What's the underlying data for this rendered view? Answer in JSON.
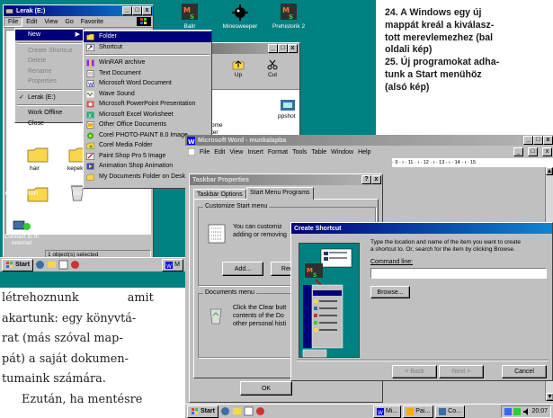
{
  "caption": {
    "line1": "24. A Windows egy új",
    "line2": "mappát kreál a kiválasz-",
    "line3": "tott merevlemezhez (bal",
    "line4": "oldali kép)",
    "line5": "25. Új programokat adha-",
    "line6": "tunk a Start menühöz",
    "line7": "(alsó kép)"
  },
  "body_text": {
    "line1": "létrehoznunk amit",
    "line2": "akartunk: egy könyvtá-",
    "line3": "rat (más szóval map-",
    "line4": "pát) a saját dokumen-",
    "line5": "tumaink számára.",
    "line6": "Ezután, ha mentésre"
  },
  "desktop_icons": [
    {
      "label": "Ballr",
      "icon": "ms-logo-icon"
    },
    {
      "label": "Minesweeper",
      "icon": "mine-icon"
    },
    {
      "label": "Prehistorik 2",
      "icon": "ms-logo-icon"
    }
  ],
  "explorer": {
    "title": "Lerak (E:)",
    "menu": [
      "File",
      "Edit",
      "View",
      "Go",
      "Favorite"
    ],
    "file_menu": [
      {
        "label": "New",
        "highlight": true
      },
      {
        "label": "Create Shortcut",
        "disabled": true
      },
      {
        "label": "Delete",
        "disabled": true
      },
      {
        "label": "Rename",
        "disabled": true
      },
      {
        "label": "Properties",
        "disabled": true
      },
      {
        "label": "Lerak (E:)",
        "checked": true
      },
      {
        "label": "Work Offline"
      },
      {
        "label": "Close"
      }
    ],
    "new_submenu": [
      {
        "label": "Folder",
        "icon": "folder-icon",
        "highlight": true
      },
      {
        "label": "Shortcut",
        "icon": "shortcut-icon"
      },
      {
        "label": "WinRAR archive",
        "icon": "winrar-icon"
      },
      {
        "label": "Text Document",
        "icon": "text-doc-icon"
      },
      {
        "label": "Microsoft Word Document",
        "icon": "word-doc-icon"
      },
      {
        "label": "Wave Sound",
        "icon": "wave-sound-icon"
      },
      {
        "label": "Microsoft PowerPoint Presentation",
        "icon": "powerpoint-icon"
      },
      {
        "label": "Microsoft Excel Worksheet",
        "icon": "excel-icon"
      },
      {
        "label": "Other Office Documents",
        "icon": "office-doc-icon"
      },
      {
        "label": "Corel PHOTO-PAINT 8.0 Image",
        "icon": "corel-icon"
      },
      {
        "label": "Corel Media Folder",
        "icon": "corel-media-icon"
      },
      {
        "label": "Paint Shop Pro 5 Image",
        "icon": "paint-shop-icon"
      },
      {
        "label": "Animation Shop Animation",
        "icon": "animation-icon"
      },
      {
        "label": "My Documents Folder on Desktop",
        "icon": "folder-icon"
      }
    ],
    "folders": [
      "hair",
      "kepek"
    ],
    "status": "1 object(s) selected"
  },
  "explorer_partial": {
    "tool_labels": [
      "Up",
      "Cut"
    ],
    "item1": "ppshot",
    "item2": "agnes",
    "item3": "pme",
    "item4": "ter"
  },
  "desktop_left": {
    "icon1_label_a": "COMPLRAR",
    "icon1_label_b": "(2)",
    "icon2_label_a": "Connect to th",
    "icon2_label_b": "Internet",
    "scheduled": "Scheduled Tasks"
  },
  "taskbar_top": {
    "start": "Start",
    "btn": "M"
  },
  "word": {
    "title": "Microsoft Word - munkalapba",
    "menu": [
      "File",
      "Edit",
      "View",
      "Insert",
      "Format",
      "Tools",
      "Table",
      "Window",
      "Help"
    ],
    "ruler": "· 9 · ı · 11 · ı · 12 · ı · 13 · ı · 14 · ı · 15"
  },
  "taskbar_props": {
    "title": "Taskbar Properties",
    "tabs": [
      "Taskbar Options",
      "Start Menu Programs"
    ],
    "group1": "Customize Start menu",
    "text1a": "You can customiz",
    "text1b": "adding or removing",
    "add": "Add...",
    "remove": "Remov",
    "group2": "Documents menu",
    "text2a": "Click the Clear butt",
    "text2b": "contents of the Do",
    "text2c": "other personal histi",
    "ok": "OK"
  },
  "create_shortcut": {
    "title": "Create Shortcut",
    "instr1": "Type the location and name of the item you want to create",
    "instr2": "a shortcut to. Or, search for the item by clicking Browse.",
    "cmd_label": "Command line:",
    "cmd_value": "",
    "browse": "Browse...",
    "back": "< Back",
    "next": "Next >",
    "cancel": "Cancel"
  },
  "taskbar_bottom": {
    "start": "Start",
    "tasks": [
      "Mi...",
      "Pai...",
      "Co..."
    ],
    "time": "20:07"
  },
  "colors": {
    "title_active": "#00007b",
    "title_inactive": "#7b7b7b",
    "desktop": "#008080",
    "caption_text": "#1a1a1a"
  }
}
